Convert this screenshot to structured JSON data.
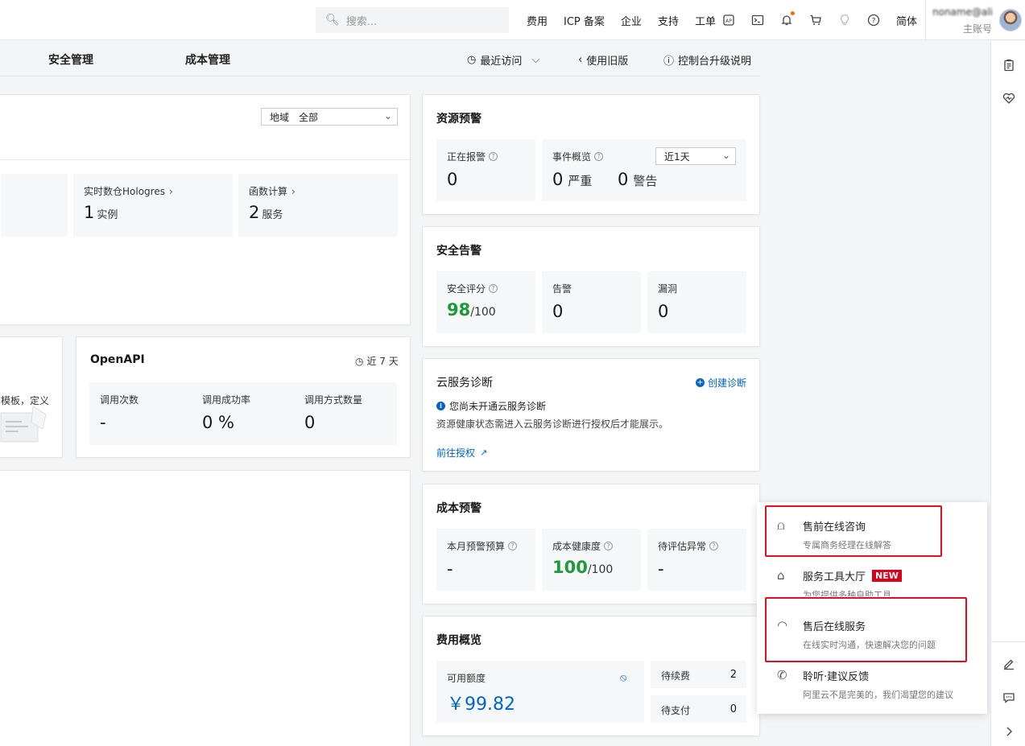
{
  "header": {
    "search_placeholder": "搜索...",
    "links": [
      "费用",
      "ICP 备案",
      "企业",
      "支持",
      "工单"
    ],
    "icons": [
      "api-icon",
      "terminal-icon",
      "bell-icon",
      "cart-icon",
      "bulb-icon",
      "help-icon"
    ],
    "language": "简体",
    "account_name": "noname@aliyun",
    "account_role": "主账号"
  },
  "subnav": {
    "tabs": [
      "安全管理",
      "成本管理"
    ],
    "recent": "最近访问",
    "old_version": "使用旧版",
    "upgrade_notes": "控制台升级说明"
  },
  "resources": {
    "region_label": "地域",
    "region_value": "全部",
    "tiles": [
      {
        "label": "实时数仓Hologres",
        "value": "1",
        "unit": "实例"
      },
      {
        "label": "函数计算",
        "value": "2",
        "unit": "服务"
      }
    ]
  },
  "template_card": {
    "text_fragment": "模板，定义"
  },
  "openapi": {
    "title": "OpenAPI",
    "period": "近 7 天",
    "stats": [
      {
        "label": "调用次数",
        "value": "-"
      },
      {
        "label": "调用成功率",
        "value": "0 %"
      },
      {
        "label": "调用方式数量",
        "value": "0"
      }
    ]
  },
  "resource_alert": {
    "title": "资源预警",
    "alarming_label": "正在报警",
    "alarming_value": "0",
    "events_label": "事件概览",
    "period": "近1天",
    "severe_value": "0",
    "severe_label": "严重",
    "warn_value": "0",
    "warn_label": "警告"
  },
  "security_alert": {
    "title": "安全告警",
    "score_label": "安全评分",
    "score_value": "98",
    "score_max": "/100",
    "alerts_label": "告警",
    "alerts_value": "0",
    "vuln_label": "漏洞",
    "vuln_value": "0"
  },
  "diagnosis": {
    "title": "云服务诊断",
    "create": "创建诊断",
    "notice": "您尚未开通云服务诊断",
    "desc": "资源健康状态需进入云服务诊断进行授权后才能展示。",
    "authorize": "前往授权"
  },
  "cost_alert": {
    "title": "成本预警",
    "budget_label": "本月预警预算",
    "budget_value": "-",
    "health_label": "成本健康度",
    "health_value": "100",
    "health_max": "/100",
    "anomaly_label": "待评估异常",
    "anomaly_value": "-"
  },
  "billing": {
    "title": "费用概览",
    "balance_label": "可用额度",
    "balance_value": "￥99.82",
    "renew_label": "待续费",
    "renew_value": "2",
    "pay_label": "待支付",
    "pay_value": "0"
  },
  "service_popup": {
    "items": [
      {
        "title": "售前在线咨询",
        "desc": "专属商务经理在线解答"
      },
      {
        "title": "服务工具大厅",
        "badge": "NEW",
        "desc": "为您提供多种自助工具"
      },
      {
        "title": "售后在线服务",
        "desc": "在线实时沟通，快速解决您的问题"
      },
      {
        "title": "聆听·建议反馈",
        "desc": "阿里云不是完美的，我们渴望您的建议"
      }
    ]
  },
  "colors": {
    "accent_blue": "#0064c8",
    "green": "#1e9a3a",
    "new_badge": "#d9001b",
    "highlight_red": "#e0101e"
  }
}
